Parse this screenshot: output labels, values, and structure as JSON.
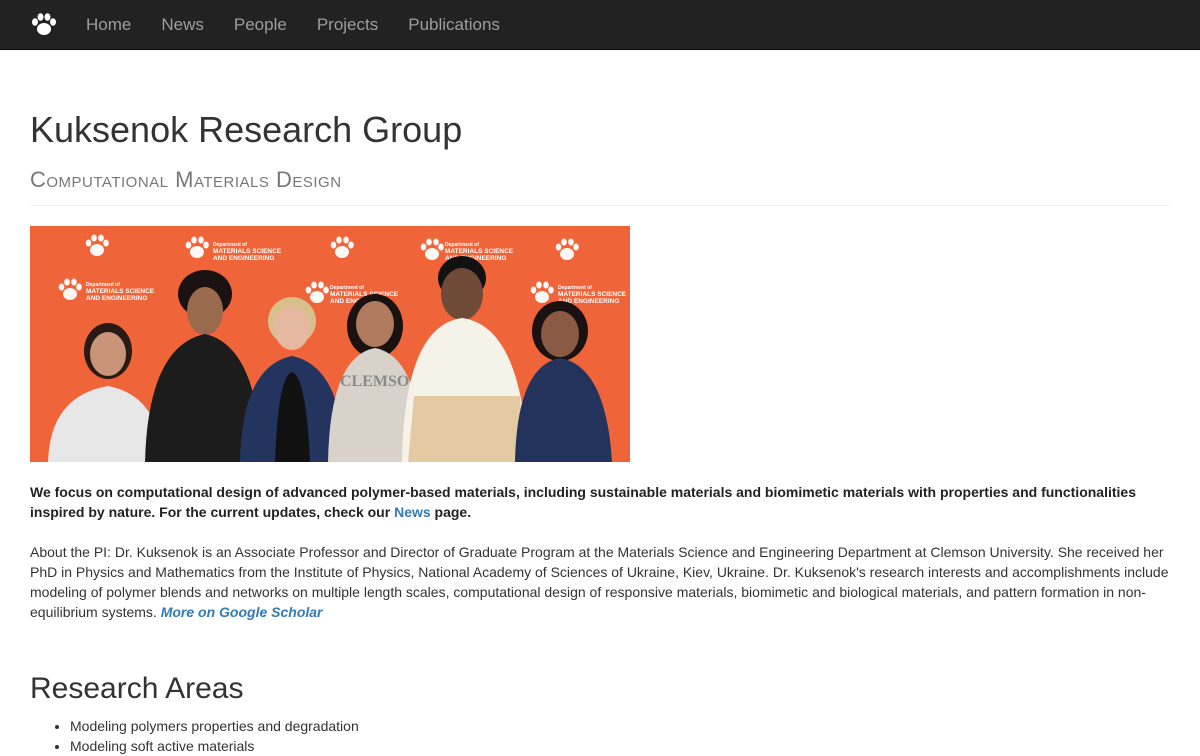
{
  "nav": {
    "brand_icon": "paw-icon",
    "items": [
      {
        "label": "Home"
      },
      {
        "label": "News"
      },
      {
        "label": "People"
      },
      {
        "label": "Projects"
      },
      {
        "label": "Publications"
      }
    ]
  },
  "header": {
    "title": "Kuksenok Research Group",
    "subtitle": "Computational Materials Design"
  },
  "photo": {
    "backdrop_color": "#f0643a",
    "backdrop_logos": [
      "Department of",
      "MATERIALS SCIENCE",
      "AND ENGINEERING"
    ],
    "shirt_text": "CLEMSON"
  },
  "intro": {
    "text_before": "We focus on computational design of advanced polymer-based materials, including sustainable materials and biomimetic materials with properties and functionalities inspired by nature. For the current updates, check our ",
    "link": "News",
    "text_after": " page."
  },
  "pi": {
    "text": "About the PI: Dr. Kuksenok is an Associate Professor and Director of Graduate Program at the Materials Science and Engineering Department at Clemson University. She received her PhD in Physics and Mathematics from the Institute of Physics, National Academy of Sciences of Ukraine, Kiev, Ukraine. Dr. Kuksenok's research interests and accomplishments include modeling of polymer blends and networks on multiple length scales, computational design of responsive materials, biomimetic and biological materials, and pattern formation in non-equilibrium systems. ",
    "link": "More on Google Scholar"
  },
  "research": {
    "heading": "Research Areas",
    "items": [
      "Modeling polymers properties and degradation",
      "Modeling soft active materials"
    ]
  },
  "colors": {
    "navbar": "#222222",
    "nav_text": "#9d9d9d",
    "link": "#337ab7",
    "clemson_orange": "#f0643a"
  }
}
